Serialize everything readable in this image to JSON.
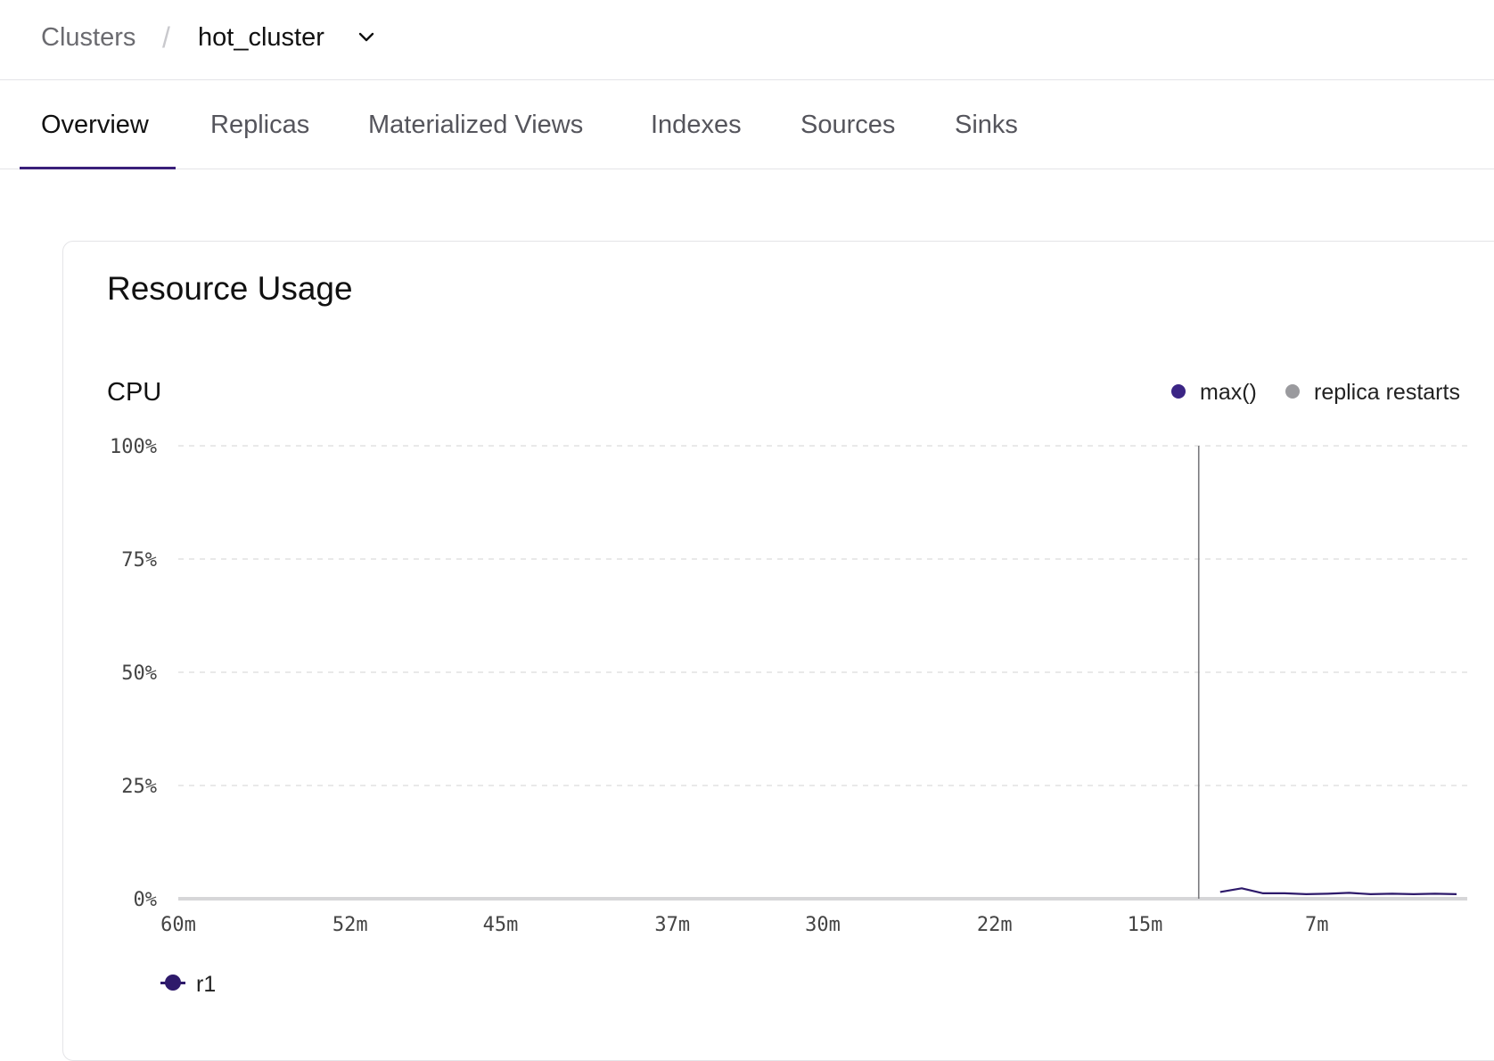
{
  "breadcrumb": {
    "root": "Clusters",
    "separator": "/",
    "current": "hot_cluster",
    "dropdown_icon": "chevron-down-icon"
  },
  "tabs": [
    {
      "label": "Overview",
      "active": true
    },
    {
      "label": "Replicas",
      "active": false
    },
    {
      "label": "Materialized Views",
      "active": false
    },
    {
      "label": "Indexes",
      "active": false
    },
    {
      "label": "Sources",
      "active": false
    },
    {
      "label": "Sinks",
      "active": false
    }
  ],
  "card": {
    "title": "Resource Usage"
  },
  "colors": {
    "accent": "#3a1f7a",
    "series_r1": "#2e1a6b",
    "restart_marker": "#9a9a9e",
    "grid": "#dcdcdc"
  },
  "cpu_chart": {
    "title": "CPU",
    "legend": [
      {
        "label": "max()",
        "color": "#3b2585"
      },
      {
        "label": "replica restarts",
        "color": "#9a9a9e"
      }
    ],
    "series_legend": [
      {
        "label": "r1",
        "color": "#2e1a6b"
      }
    ]
  },
  "chart_data": {
    "type": "line",
    "title": "CPU",
    "xlabel": "",
    "ylabel": "",
    "y_ticks": [
      "0%",
      "25%",
      "50%",
      "75%",
      "100%"
    ],
    "x_ticks": [
      "60m",
      "52m",
      "45m",
      "37m",
      "30m",
      "22m",
      "15m",
      "7m"
    ],
    "xlim_minutes_ago": [
      60,
      0
    ],
    "ylim_percent": [
      0,
      100
    ],
    "grid": true,
    "legend_placement": "top-right",
    "replica_restarts_minutes_ago": [
      12.5
    ],
    "series": [
      {
        "name": "r1",
        "x_minutes_ago": [
          11.5,
          10.5,
          9.5,
          8.5,
          7.5,
          6.5,
          5.5,
          4.5,
          3.5,
          2.5,
          1.5,
          0.5
        ],
        "y_percent": [
          1.5,
          2.3,
          1.2,
          1.2,
          1.0,
          1.1,
          1.3,
          1.0,
          1.1,
          1.0,
          1.1,
          1.0
        ]
      }
    ]
  }
}
